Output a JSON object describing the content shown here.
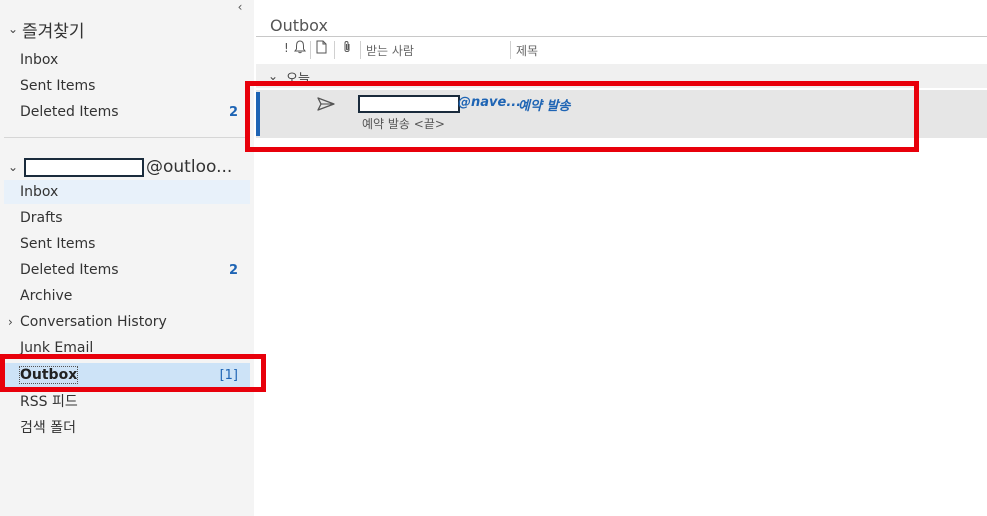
{
  "sidebar": {
    "favorites_label": "즐겨찾기",
    "favorites": [
      {
        "label": "Inbox",
        "count": ""
      },
      {
        "label": "Sent Items",
        "count": ""
      },
      {
        "label": "Deleted Items",
        "count": "2"
      }
    ],
    "account_suffix": "@outloo...",
    "folders": [
      {
        "label": "Inbox",
        "count": ""
      },
      {
        "label": "Drafts",
        "count": ""
      },
      {
        "label": "Sent Items",
        "count": ""
      },
      {
        "label": "Deleted Items",
        "count": "2"
      },
      {
        "label": "Archive",
        "count": ""
      },
      {
        "label": "Conversation History",
        "count": ""
      },
      {
        "label": "Junk Email",
        "count": ""
      },
      {
        "label": "Outbox",
        "count": "[1]"
      },
      {
        "label": "RSS 피드",
        "count": ""
      },
      {
        "label": "검색 폴더",
        "count": ""
      }
    ]
  },
  "main": {
    "folder_title": "Outbox",
    "columns": {
      "importance_icon": "!",
      "recipient": "받는 사람",
      "subject": "제목"
    },
    "group_label": "오늘",
    "message": {
      "sender_suffix": "@nave...",
      "subject": "예약 발송",
      "preview": "예약 발송 <끝>"
    }
  },
  "colors": {
    "accent": "#1e64b4",
    "highlight_box": "#e8000b",
    "selected": "#cde3f7"
  },
  "icons": {
    "collapse": "chevron-left-icon",
    "reminder": "bell-icon",
    "attachment": "paperclip-icon",
    "document": "document-icon",
    "send": "send-icon"
  }
}
